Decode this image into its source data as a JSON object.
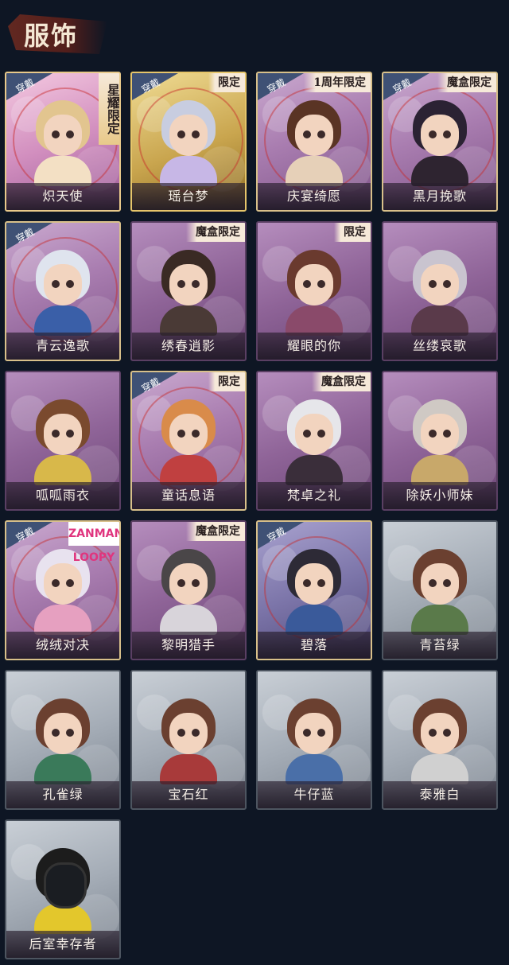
{
  "header": {
    "title": "服饰"
  },
  "labels": {
    "worn": "穿戴"
  },
  "colors": {
    "background": "#0e1624",
    "accent_gold": "#e6c56a",
    "tag_bg": "#f6e9d9",
    "worn_badge": "#3f5175"
  },
  "items": [
    {
      "name": "炽天使",
      "worn": true,
      "tag": "星耀限定",
      "style": "pinkgold"
    },
    {
      "name": "瑶台梦",
      "worn": true,
      "tag": "限定",
      "style": "gold"
    },
    {
      "name": "庆宴绮愿",
      "worn": true,
      "tag": "1周年限定",
      "style": "purple"
    },
    {
      "name": "黑月挽歌",
      "worn": true,
      "tag": "魔盒限定",
      "style": "purple"
    },
    {
      "name": "青云逸歌",
      "worn": true,
      "tag": "",
      "style": "purple"
    },
    {
      "name": "绣春逍影",
      "worn": false,
      "tag": "魔盒限定",
      "style": "plain-purple"
    },
    {
      "name": "耀眼的你",
      "worn": false,
      "tag": "限定",
      "style": "plain-purple"
    },
    {
      "name": "丝缕哀歌",
      "worn": false,
      "tag": "",
      "style": "plain-purple"
    },
    {
      "name": "呱呱雨衣",
      "worn": false,
      "tag": "",
      "style": "plain-purple"
    },
    {
      "name": "童话息语",
      "worn": true,
      "tag": "限定",
      "style": "purple"
    },
    {
      "name": "梵卓之礼",
      "worn": false,
      "tag": "魔盒限定",
      "style": "plain-purple"
    },
    {
      "name": "除妖小师妹",
      "worn": false,
      "tag": "",
      "style": "plain-purple"
    },
    {
      "name": "绒绒对决",
      "worn": true,
      "tag": "ZANMANG LOOPY",
      "style": "purple"
    },
    {
      "name": "黎明猎手",
      "worn": false,
      "tag": "魔盒限定",
      "style": "plain-purple"
    },
    {
      "name": "碧落",
      "worn": true,
      "tag": "",
      "style": "blue-purple"
    },
    {
      "name": "青苔绿",
      "worn": false,
      "tag": "",
      "style": "gray"
    },
    {
      "name": "孔雀绿",
      "worn": false,
      "tag": "",
      "style": "gray"
    },
    {
      "name": "宝石红",
      "worn": false,
      "tag": "",
      "style": "gray"
    },
    {
      "name": "牛仔蓝",
      "worn": false,
      "tag": "",
      "style": "gray"
    },
    {
      "name": "泰雅白",
      "worn": false,
      "tag": "",
      "style": "gray"
    },
    {
      "name": "后室幸存者",
      "worn": false,
      "tag": "",
      "style": "gray"
    }
  ]
}
